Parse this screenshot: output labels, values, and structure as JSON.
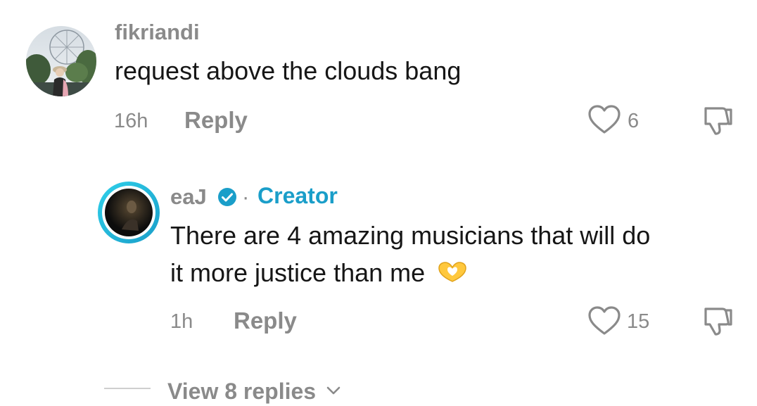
{
  "comments": [
    {
      "username": "fikriandi",
      "text": "request above the clouds bang",
      "time": "16h",
      "reply_label": "Reply",
      "likes": "6"
    }
  ],
  "reply": {
    "username": "eaJ",
    "separator": "·",
    "creator_label": "Creator",
    "text_line1": "There are 4 amazing musicians that will do",
    "text_line2": "it more justice than me",
    "emoji": "🫶",
    "time": "1h",
    "reply_label": "Reply",
    "likes": "15"
  },
  "view_replies": {
    "label": "View 8 replies"
  },
  "colors": {
    "accent": "#1a9ec9",
    "muted": "#8a8a8a",
    "creator_ring_start": "#27c8e6",
    "creator_ring_end": "#1a9ec9"
  },
  "icons": {
    "like": "heart-outline-icon",
    "dislike": "thumbs-down-icon",
    "verified": "verified-badge-icon",
    "expand": "chevron-down-icon"
  }
}
